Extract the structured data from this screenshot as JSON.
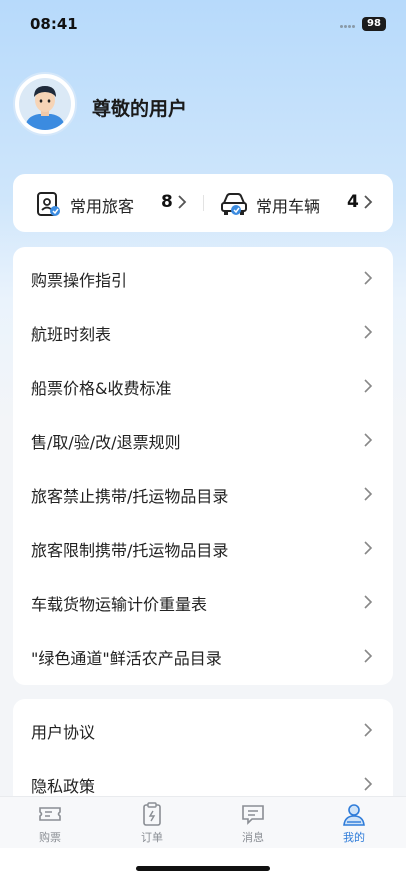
{
  "status_bar": {
    "time": "08:41",
    "battery": "98"
  },
  "profile": {
    "username": "尊敬的用户",
    "avatar_icon": "user-avatar-icon"
  },
  "shortcuts": [
    {
      "label": "常用旅客",
      "count": "8",
      "icon": "passenger-id-icon"
    },
    {
      "label": "常用车辆",
      "count": "4",
      "icon": "car-icon"
    }
  ],
  "menu_group_1": [
    {
      "label": "购票操作指引"
    },
    {
      "label": "航班时刻表"
    },
    {
      "label": "船票价格&收费标准"
    },
    {
      "label": "售/取/验/改/退票规则"
    },
    {
      "label": "旅客禁止携带/托运物品目录"
    },
    {
      "label": "旅客限制携带/托运物品目录"
    },
    {
      "label": "车载货物运输计价重量表"
    },
    {
      "label": "\"绿色通道\"鲜活农产品目录"
    }
  ],
  "menu_group_2": [
    {
      "label": "用户协议"
    },
    {
      "label": "隐私政策"
    }
  ],
  "tab_bar": [
    {
      "label": "购票",
      "icon": "ticket-icon",
      "active": false
    },
    {
      "label": "订单",
      "icon": "order-clipboard-icon",
      "active": false
    },
    {
      "label": "消息",
      "icon": "message-icon",
      "active": false
    },
    {
      "label": "我的",
      "icon": "profile-icon",
      "active": true
    }
  ],
  "colors": {
    "accent": "#2f7cd9",
    "background_top": "#b7dafb",
    "background": "#f3f5f8"
  }
}
